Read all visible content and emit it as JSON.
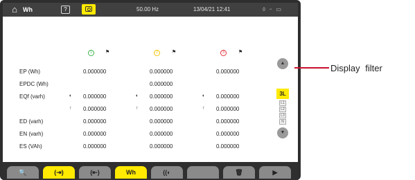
{
  "topbar": {
    "home_icon": "home-icon",
    "mode": "Wh",
    "help": "?",
    "frequency": "50.00 Hz",
    "datetime": "13/04/21 12:41",
    "status_icons": "◊ ᵕ ▭"
  },
  "phases": [
    {
      "label": "1",
      "color": "#3cb44b"
    },
    {
      "label": "2",
      "color": "#f5c400"
    },
    {
      "label": "3",
      "color": "#e0303a"
    }
  ],
  "phase_flag": "⚑",
  "rows": [
    {
      "label": "EP (Wh)",
      "values": [
        "0.000000",
        "0.000000",
        "0.000000"
      ]
    },
    {
      "label": "EPDC (Wh)",
      "values": [
        "",
        "0.000000",
        ""
      ]
    },
    {
      "label": "EQf (varh)",
      "symbol": "◖",
      "values": [
        "0.000000",
        "0.000000",
        "0.000000"
      ]
    },
    {
      "label": "",
      "symbol": "↑",
      "values": [
        "0.000000",
        "0.000000",
        "0.000000"
      ]
    },
    {
      "label": "ED (varh)",
      "values": [
        "0.000000",
        "0.000000",
        "0.000000"
      ]
    },
    {
      "label": "EN (varh)",
      "values": [
        "0.000000",
        "0.000000",
        "0.000000"
      ]
    },
    {
      "label": "ES (VAh)",
      "values": [
        "0.000000",
        "0.000000",
        "0.000000"
      ]
    }
  ],
  "filter": {
    "up": "▲",
    "down": "▼",
    "selected": "3L",
    "options": [
      "L1",
      "L2",
      "L3",
      "N"
    ]
  },
  "toolbar": {
    "buttons": [
      {
        "label": "🔍",
        "icon": "zoom-icon"
      },
      {
        "label": "(⇥)",
        "icon": "start-energy-icon"
      },
      {
        "label": "(⇤)",
        "icon": "stop-energy-icon"
      },
      {
        "label": "Wh",
        "icon": "wh-unit"
      },
      {
        "label": "((◐",
        "icon": "quadrant-icon"
      },
      {
        "label": "",
        "icon": "blank"
      },
      {
        "label": "🗑",
        "icon": "trash-icon"
      },
      {
        "label": "▶",
        "icon": "next-icon"
      }
    ]
  },
  "callout": {
    "label": "Display  filter",
    "color": "#c8102e"
  }
}
